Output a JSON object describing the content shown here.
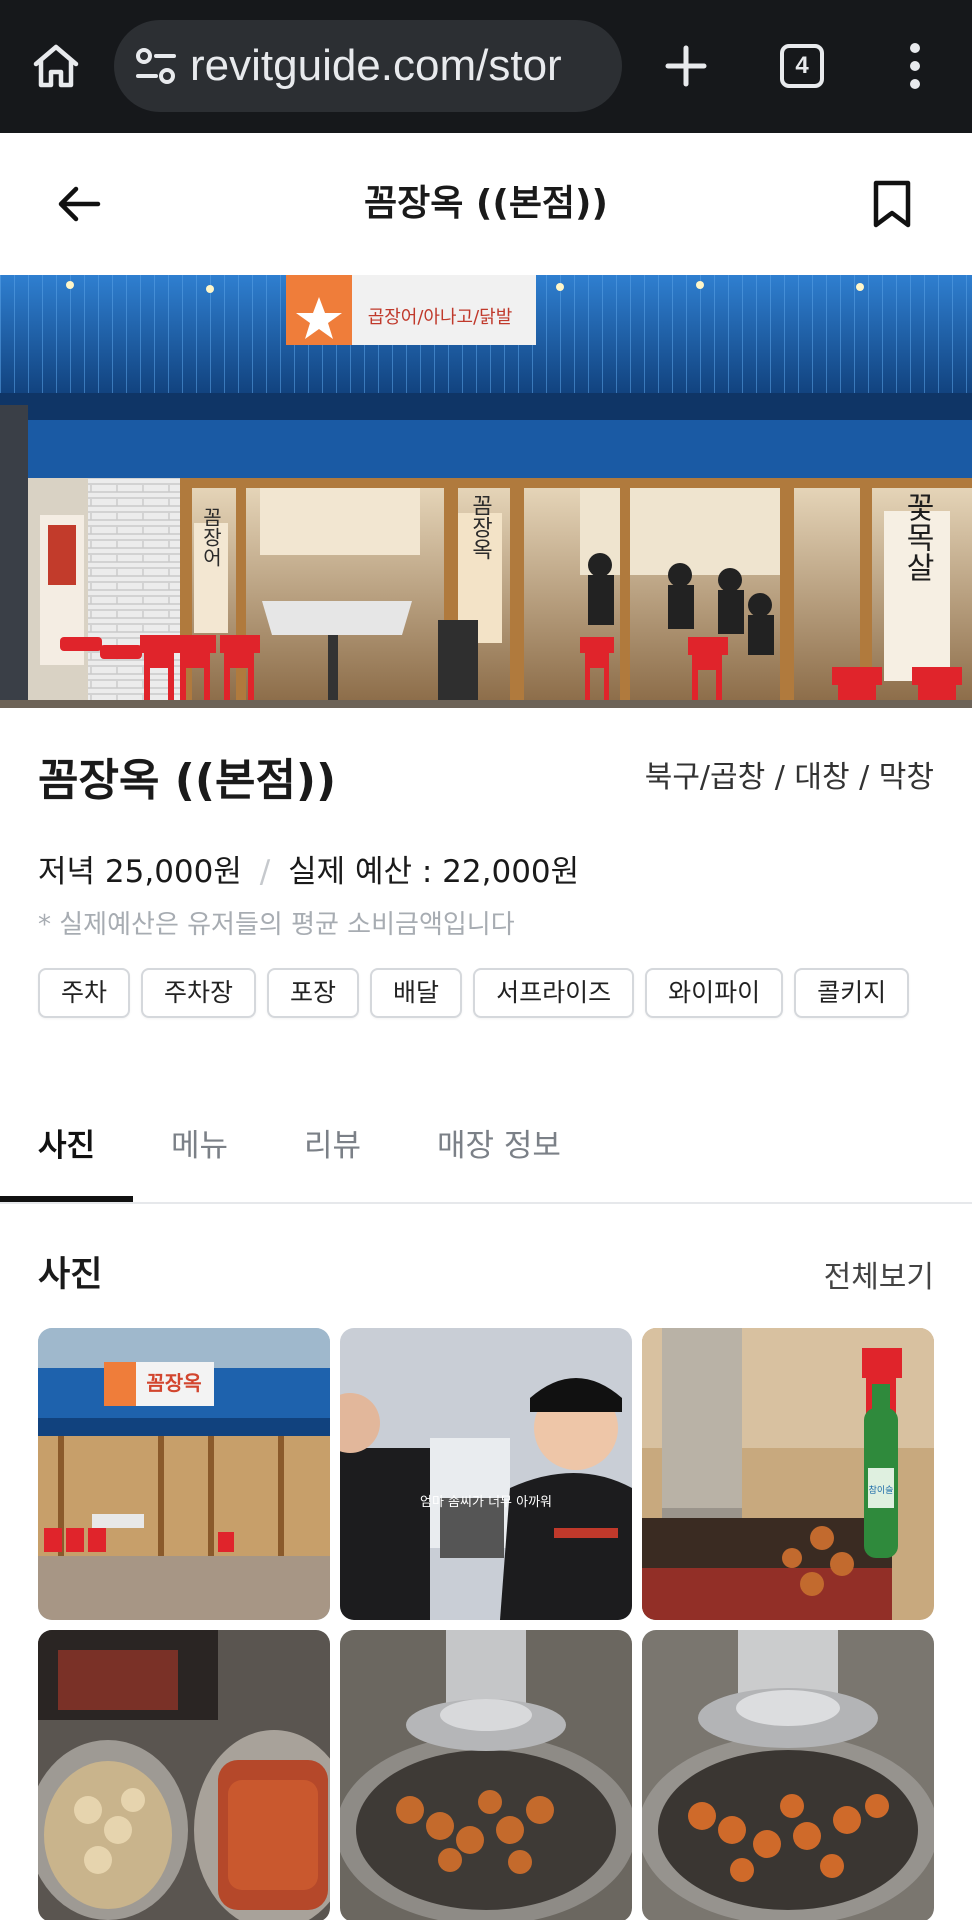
{
  "browser": {
    "url": "revitguide.com/stor",
    "tab_count": "4",
    "icons": [
      "home-icon",
      "site-settings-icon",
      "new-tab-icon",
      "tab-switcher-icon",
      "more-vert-icon"
    ]
  },
  "header": {
    "title": "꼼장옥 ((본점))",
    "icons": [
      "back-arrow-icon",
      "bookmark-icon"
    ]
  },
  "store": {
    "name": "꼼장옥 ((본점))",
    "category": "북구/곱창 / 대창 / 막창",
    "price_label": "저녁",
    "price_value": "25,000원",
    "separator": "/",
    "budget_label": "실제 예산 :",
    "budget_value": "22,000원",
    "note": "* 실제예산은 유저들의 평균 소비금액입니다",
    "tags": [
      "주차",
      "주차장",
      "포장",
      "배달",
      "서프라이즈",
      "와이파이",
      "콜키지"
    ]
  },
  "hero_sign": {
    "text": "곱장어/아나고/닭발",
    "door_text_left": "꼼장어",
    "door_text_center": "꼼장옥",
    "door_text_right": "꽃목살"
  },
  "tabs": [
    "사진",
    "메뉴",
    "리뷰",
    "매장 정보"
  ],
  "active_tab": "사진",
  "photos": {
    "title": "사진",
    "view_all": "전체보기",
    "thumb_sign": "꼼장옥",
    "thumb_caption": "엄마 솜씨가 너무 아까워",
    "soju_label": "참이슬"
  },
  "colors": {
    "chrome_bg": "#16181b",
    "url_bar_bg": "#2c2f33",
    "awning_blue": "#1c5fa8",
    "sign_orange": "#ef7d3a",
    "chair_red": "#e0242b"
  }
}
